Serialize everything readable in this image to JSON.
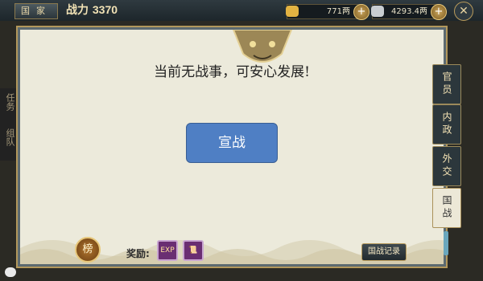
{
  "topbar": {
    "country_label": "国家",
    "power_label": "战力",
    "power_value": "3370",
    "gold": "771两",
    "silver": "4293.4两"
  },
  "panel": {
    "message": "当前无战事，可安心发展!",
    "declare_war": "宣战",
    "reward_label": "奖励:",
    "rank_button": "榜",
    "record_button": "国战记录"
  },
  "tabs": [
    {
      "label": "官员",
      "active": false
    },
    {
      "label": "内政",
      "active": false
    },
    {
      "label": "外交",
      "active": false
    },
    {
      "label": "国战",
      "active": true
    }
  ],
  "side_hint": [
    "任务",
    "组队"
  ],
  "colors": {
    "button_blue": "#4f7fc4",
    "parchment": "#eceadb",
    "frame_dark": "#5c6a70",
    "gold": "#b3985c"
  }
}
